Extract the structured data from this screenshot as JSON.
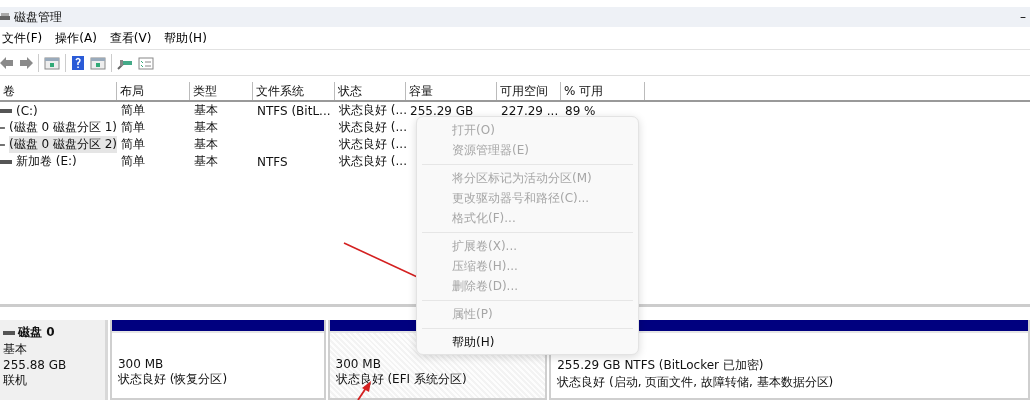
{
  "window": {
    "title": "磁盘管理",
    "minimize": "–"
  },
  "menu": [
    "文件(F)",
    "操作(A)",
    "查看(V)",
    "帮助(H)"
  ],
  "toolbar": [
    {
      "kind": "back"
    },
    {
      "kind": "forward"
    },
    {
      "kind": "sep"
    },
    {
      "kind": "tree"
    },
    {
      "kind": "sep"
    },
    {
      "kind": "help"
    },
    {
      "kind": "pane"
    },
    {
      "kind": "sep"
    },
    {
      "kind": "connect"
    },
    {
      "kind": "props"
    }
  ],
  "table": {
    "columns": [
      "卷",
      "布局",
      "类型",
      "文件系统",
      "状态",
      "容量",
      "可用空间",
      "% 可用"
    ],
    "rows": [
      {
        "selected": false,
        "cells": [
          "(C:)",
          "简单",
          "基本",
          "NTFS (BitL...",
          "状态良好 (...",
          "255.29 GB",
          "227.29 ...",
          "89 %"
        ]
      },
      {
        "selected": false,
        "cells": [
          "(磁盘 0 磁盘分区 1)",
          "简单",
          "基本",
          "",
          "状态良好 (...",
          "",
          "",
          ""
        ]
      },
      {
        "selected": true,
        "cells": [
          "(磁盘 0 磁盘分区 2)",
          "简单",
          "基本",
          "",
          "状态良好 (...",
          "",
          "",
          ""
        ]
      },
      {
        "selected": false,
        "cells": [
          "新加卷 (E:)",
          "简单",
          "基本",
          "NTFS",
          "状态良好 (...",
          "",
          "",
          ""
        ]
      }
    ]
  },
  "context_menu": [
    {
      "kind": "item",
      "label": "打开(O)",
      "disabled": true
    },
    {
      "kind": "item",
      "label": "资源管理器(E)",
      "disabled": true
    },
    {
      "kind": "separator"
    },
    {
      "kind": "item",
      "label": "将分区标记为活动分区(M)",
      "disabled": true
    },
    {
      "kind": "item",
      "label": "更改驱动器号和路径(C)...",
      "disabled": true
    },
    {
      "kind": "item",
      "label": "格式化(F)...",
      "disabled": true
    },
    {
      "kind": "separator"
    },
    {
      "kind": "item",
      "label": "扩展卷(X)...",
      "disabled": true
    },
    {
      "kind": "item",
      "label": "压缩卷(H)...",
      "disabled": true
    },
    {
      "kind": "item",
      "label": "删除卷(D)...",
      "disabled": true
    },
    {
      "kind": "separator"
    },
    {
      "kind": "item",
      "label": "属性(P)",
      "disabled": true
    },
    {
      "kind": "separator"
    },
    {
      "kind": "item",
      "label": "帮助(H)",
      "disabled": false
    }
  ],
  "disk": {
    "name": "磁盘 0",
    "type": "基本",
    "size": "255.88 GB",
    "status": "联机",
    "partitions": [
      {
        "selected": false,
        "size": "300 MB",
        "status": "状态良好 (恢复分区)"
      },
      {
        "selected": true,
        "size": "300 MB",
        "status": "状态良好 (EFI 系统分区)"
      },
      {
        "selected": false,
        "size": "255.29 GB NTFS (BitLocker 已加密)",
        "status": "状态良好 (启动, 页面文件, 故障转储, 基本数据分区)"
      }
    ]
  }
}
